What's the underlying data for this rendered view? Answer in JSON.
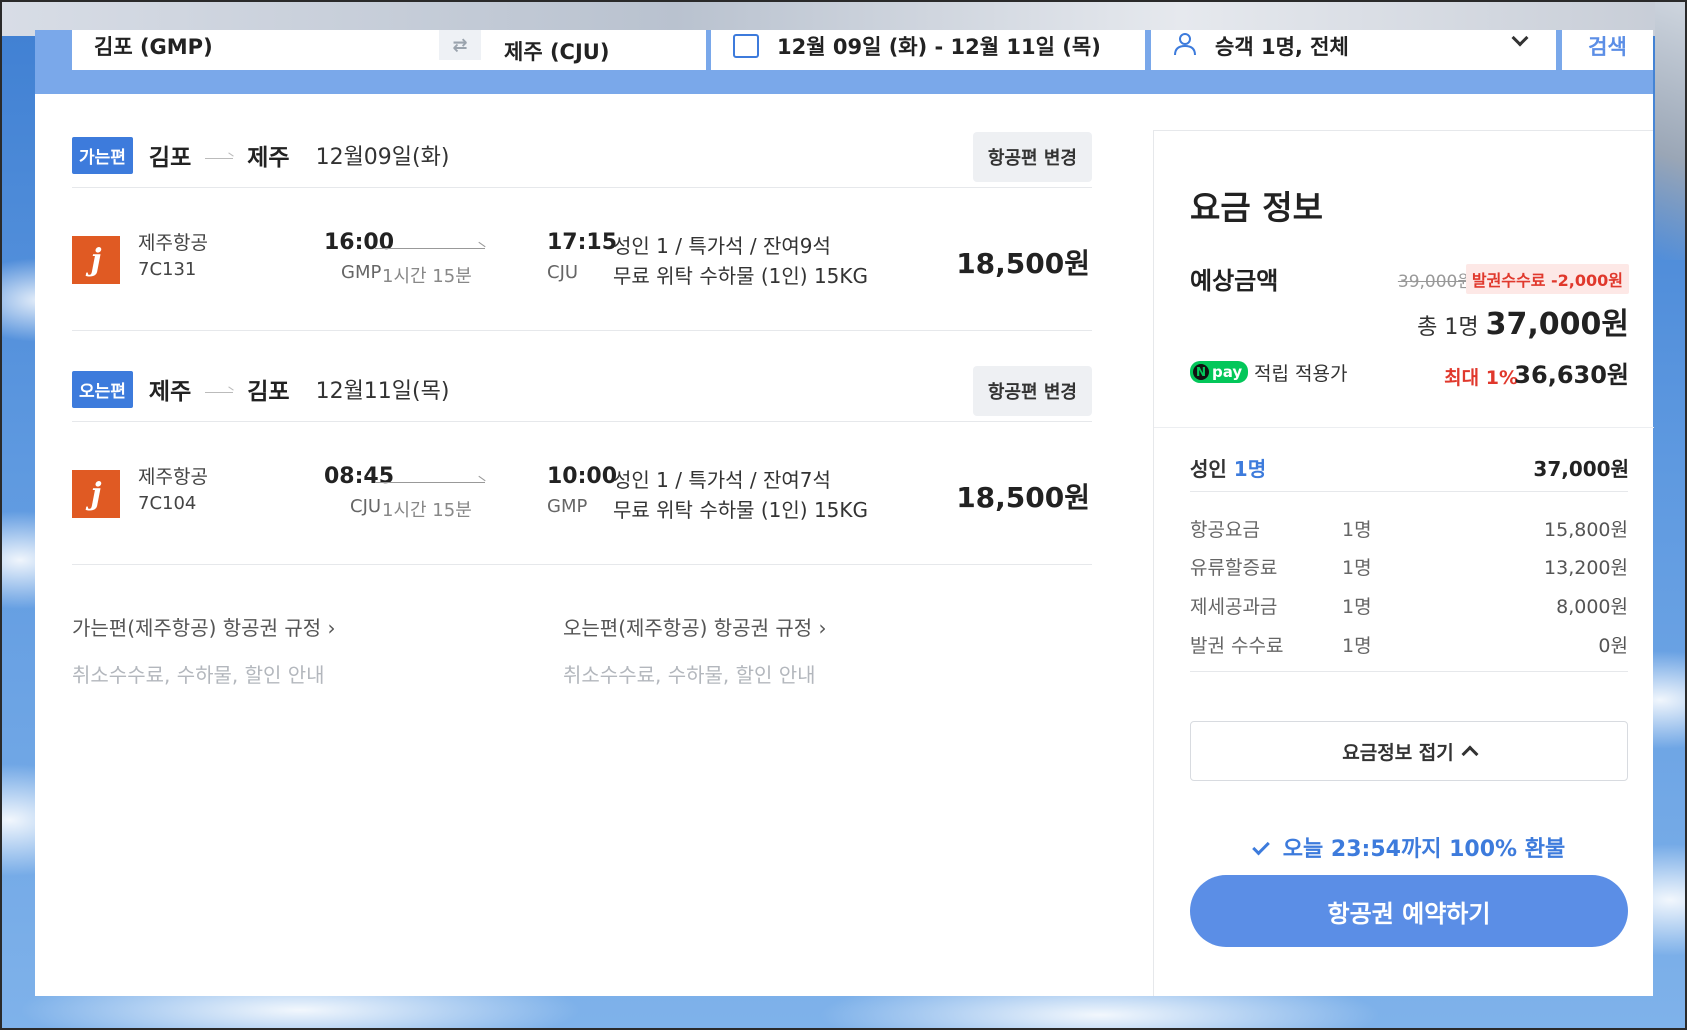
{
  "search": {
    "origin": "김포 (GMP)",
    "destination": "제주 (CJU)",
    "swap_icon": "⇄",
    "dates": "12월 09일 (화)  -  12월 11일 (목)",
    "passengers": "승객 1명, 전체",
    "search_label": "검색"
  },
  "segments": [
    {
      "badge": "가는편",
      "from": "김포",
      "to": "제주",
      "date": "12월09일(화)",
      "change_label": "항공편 변경",
      "flight": {
        "airline": "제주항공",
        "flight_no": "7C131",
        "dep_time": "16:00",
        "dep_code": "GMP",
        "duration": "1시간 15분",
        "arr_time": "17:15",
        "arr_code": "CJU",
        "seat_info": "성인 1 / 특가석 / 잔여9석",
        "baggage": "무료 위탁 수하물 (1인) 15KG",
        "price": "18,500원"
      }
    },
    {
      "badge": "오는편",
      "from": "제주",
      "to": "김포",
      "date": "12월11일(목)",
      "change_label": "항공편 변경",
      "flight": {
        "airline": "제주항공",
        "flight_no": "7C104",
        "dep_time": "08:45",
        "dep_code": "CJU",
        "duration": "1시간 15분",
        "arr_time": "10:00",
        "arr_code": "GMP",
        "seat_info": "성인 1 / 특가석 / 잔여7석",
        "baggage": "무료 위탁 수하물 (1인) 15KG",
        "price": "18,500원"
      }
    }
  ],
  "rules": [
    {
      "title": "가는편(제주항공) 항공권 규정 ›",
      "sub": "취소수수료, 수하물, 할인 안내"
    },
    {
      "title": "오는편(제주항공) 항공권 규정 ›",
      "sub": "취소수수료, 수하물, 할인 안내"
    }
  ],
  "fare": {
    "title": "요금 정보",
    "estimate_label": "예상금액",
    "original_price": "39,000원",
    "fee_discount": "발권수수료 -2,000원",
    "total_prefix": "총 1명",
    "total": "37,000원",
    "npay_badge": "pay",
    "npay_n": "N",
    "npay_text": "적립 적용가",
    "npay_max": "최대 1%",
    "npay_amount": "36,630원",
    "pax_label": "성인",
    "pax_count": "1명",
    "pax_amount": "37,000원",
    "breakdown": [
      {
        "name": "항공요금",
        "count": "1명",
        "amount": "15,800원"
      },
      {
        "name": "유류할증료",
        "count": "1명",
        "amount": "13,200원"
      },
      {
        "name": "제세공과금",
        "count": "1명",
        "amount": "8,000원"
      },
      {
        "name": "발권 수수료",
        "count": "1명",
        "amount": "0원"
      }
    ],
    "fold_label": "요금정보 접기",
    "refund_text": "오늘 23:54까지 100% 환불",
    "book_label": "항공권 예약하기"
  },
  "colors": {
    "accent": "#3d7bdc",
    "book_button": "#5b8ee6",
    "discount_red": "#e0382c",
    "airline_logo": "#e05a23",
    "npay_green": "#03c75a"
  }
}
